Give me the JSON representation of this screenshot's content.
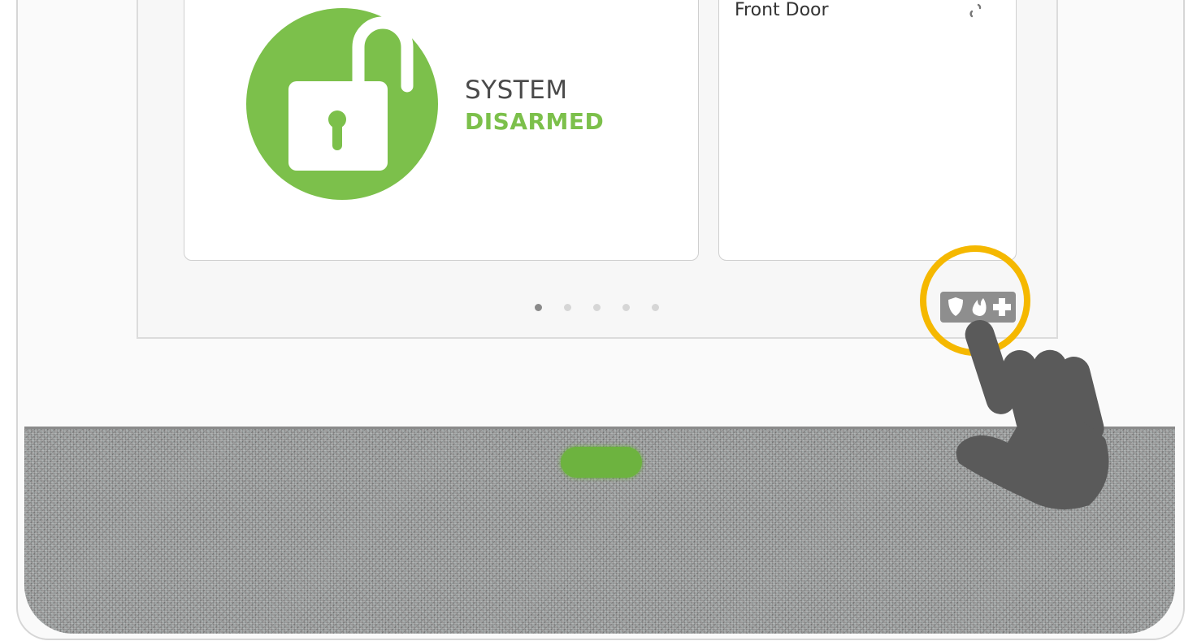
{
  "colors": {
    "armed_state_green": "#7cc04b",
    "highlight_ring": "#f5b800",
    "emergency_button": "#8e8e8e",
    "led_green": "#6db33f"
  },
  "system_card": {
    "label": "SYSTEM",
    "state": "DISARMED",
    "icon": "unlocked-padlock-icon"
  },
  "side_card": {
    "title": "Front Door",
    "icon": "link-icon"
  },
  "pagination": {
    "page_count": 5,
    "active_index": 0
  },
  "emergency_button": {
    "icons": [
      "shield-icon",
      "fire-icon",
      "medical-cross-icon"
    ]
  }
}
